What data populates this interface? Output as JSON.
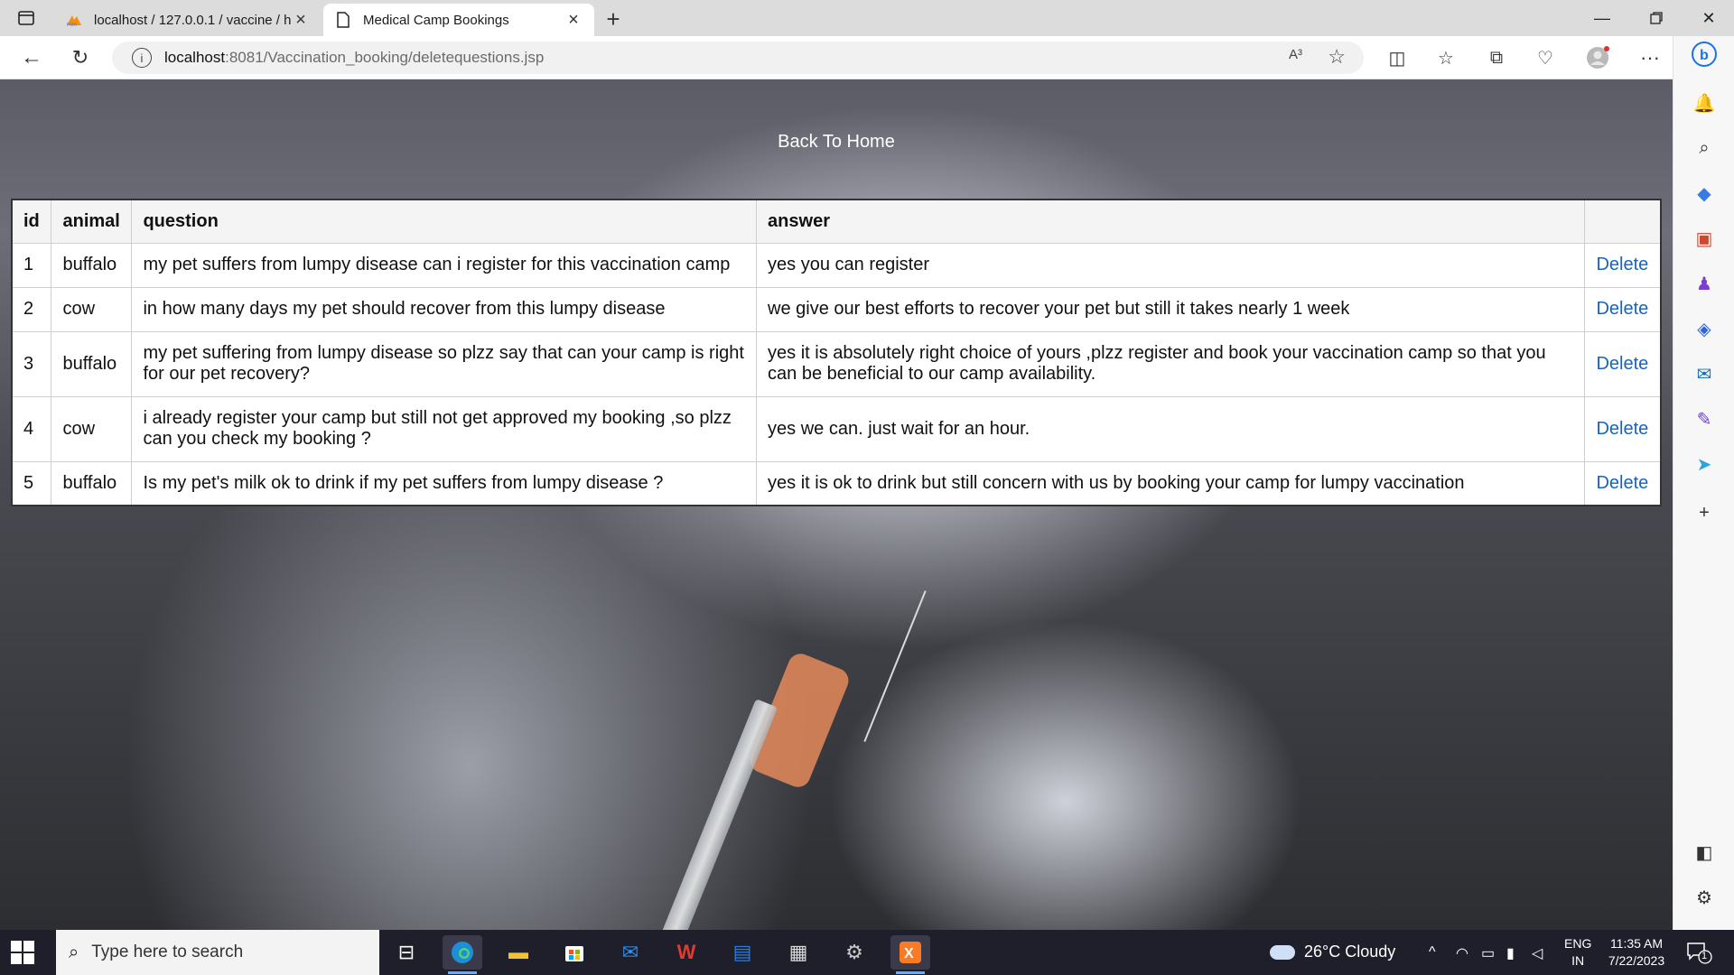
{
  "browser": {
    "tabs": [
      {
        "title": "localhost / 127.0.0.1 / vaccine / h",
        "favicon": "phpmyadmin-icon",
        "active": false
      },
      {
        "title": "Medical Camp Bookings",
        "favicon": "page-icon",
        "active": true
      }
    ],
    "url_host": "localhost",
    "url_path": ":8081/Vaccination_booking/deletequestions.jsp",
    "read_aloud_label": "A³"
  },
  "page": {
    "back_home": "Back To Home",
    "table": {
      "headers": [
        "id",
        "animal",
        "question",
        "answer",
        ""
      ],
      "rows": [
        {
          "id": "1",
          "animal": "buffalo",
          "question": "my pet suffers from lumpy disease can i register for this vaccination camp",
          "answer": "yes you can register",
          "action": "Delete"
        },
        {
          "id": "2",
          "animal": "cow",
          "question": "in how many days my pet should recover from this lumpy disease",
          "answer": "we give our best efforts to recover your pet but still it takes nearly 1 week",
          "action": "Delete"
        },
        {
          "id": "3",
          "animal": "buffalo",
          "question": "my pet suffering from lumpy disease so plzz say that can your camp is right for our pet recovery?",
          "answer": "yes it is absolutely right choice of yours ,plzz register and book your vaccination camp so that you can be beneficial to our camp availability.",
          "action": "Delete"
        },
        {
          "id": "4",
          "animal": "cow",
          "question": "i already register your camp but still not get approved my booking ,so plzz can you check my booking ?",
          "answer": "yes we can. just wait for an hour.",
          "action": "Delete"
        },
        {
          "id": "5",
          "animal": "buffalo",
          "question": "Is my pet's milk ok to drink if my pet suffers from lumpy disease ?",
          "answer": "yes it is ok to drink but still concern with us by booking your camp for lumpy vaccination",
          "action": "Delete"
        }
      ]
    }
  },
  "taskbar": {
    "search_placeholder": "Type here to search",
    "weather": "26°C  Cloudy",
    "lang_top": "ENG",
    "lang_bottom": "IN",
    "time": "11:35 AM",
    "date": "7/22/2023",
    "notification_count": "1"
  },
  "colors": {
    "link": "#1565c0",
    "taskbar": "#1f1f2b",
    "tabstrip": "#dcdcdc"
  }
}
